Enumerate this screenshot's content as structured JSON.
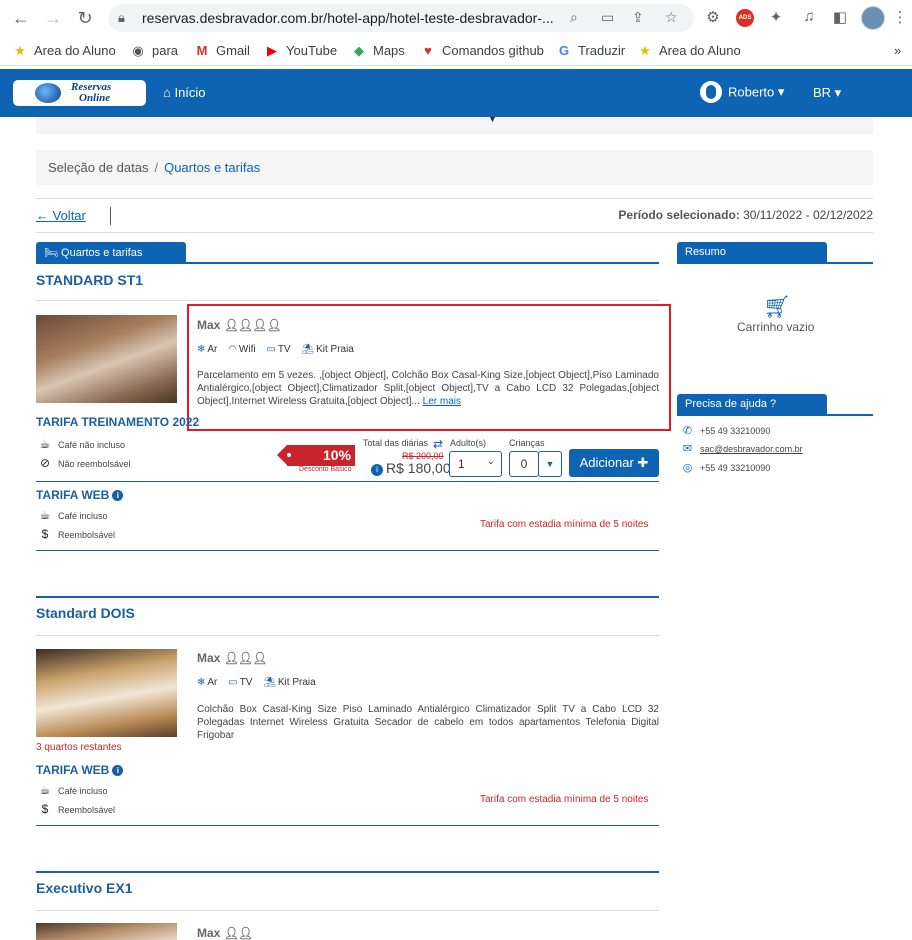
{
  "browser": {
    "url": "reservas.desbravador.com.br/hotel-app/hotel-teste-desbravador-...",
    "ads_badge": "ADS",
    "bookmarks": [
      {
        "icon": "★",
        "label": "Area do Aluno"
      },
      {
        "icon": "◉",
        "label": "para"
      },
      {
        "icon": "M",
        "label": "Gmail"
      },
      {
        "icon": "▶",
        "label": "YouTube"
      },
      {
        "icon": "◆",
        "label": "Maps"
      },
      {
        "icon": "♥",
        "label": "Comandos github"
      },
      {
        "icon": "G",
        "label": "Traduzir"
      },
      {
        "icon": "★",
        "label": "Area do Aluno"
      }
    ],
    "more": "»"
  },
  "site": {
    "logo_line1": "Reservas",
    "logo_line2": "Online",
    "home": "Início",
    "user": "Roberto",
    "lang": "BR",
    "accent": "#0e63b3"
  },
  "breadcrumb": {
    "step1": "Seleção de datas",
    "sep": "/",
    "step2": "Quartos e tarifas"
  },
  "voltar": "Voltar",
  "periodo": {
    "label": "Período selecionado:",
    "value": "30/11/2022 - 02/12/2022"
  },
  "rooms_tab": "Quartos e tarifas",
  "summary_tab": "Resumo",
  "cart_empty": "Carrinho vazio",
  "help_tab": "Precisa de ajuda ?",
  "contacts": [
    "+55 49 33210090",
    "sac@desbravador.com.br",
    "+55 49 33210090"
  ],
  "rooms": [
    {
      "title": "STANDARD ST1",
      "max": "Max",
      "amenities": [
        "Ar",
        "Wifi",
        "TV",
        "Kit Praia"
      ],
      "desc": "Parcelamento em 5 vezes. ,[object Object], Colchão Box Casal-King Size,[object Object],Piso Laminado Antialérgico,[object Object],Climatizador Split,[object Object],TV a Cabo LCD 32 Polegadas,[object Object],Internet Wireless Gratuita,[object Object]...",
      "more": "Ler mais",
      "tarifas": [
        {
          "name": "TARIFA TREINAMENTO 2022",
          "f1": "Café não incluso",
          "f2": "Não reembolsável",
          "discount": "10%",
          "discount_label": "Desconto Básico",
          "total_label": "Total das diárias",
          "old_price": "R$ 200,00",
          "price": "R$ 180,00",
          "adults_label": "Adulto(s)",
          "adults": "1",
          "children_label": "Crianças",
          "children": "0",
          "add": "Adicionar"
        },
        {
          "name": "TARIFA WEB",
          "f1": "Café incluso",
          "f2": "Reembolsável",
          "min_stay": "Tarifa com estadia mínima de 5 noites"
        }
      ]
    },
    {
      "title": "Standard DOIS",
      "max": "Max",
      "amenities": [
        "Ar",
        "TV",
        "Kit Praia"
      ],
      "desc": "Colchão Box Casal-King Size Piso Laminado Antialérgico Climatizador Split TV a Cabo LCD 32 Polegadas Internet Wireless Gratuita Secador de cabelo em todos apartamentos Telefonia Digital Frigobar",
      "remaining": "3 quartos restantes",
      "tarifa": {
        "name": "TARIFA WEB",
        "f1": "Café incluso",
        "f2": "Reembolsável",
        "min_stay": "Tarifa com estadia mínima de 5 noites"
      }
    },
    {
      "title": "Executivo EX1",
      "max": "Max"
    }
  ]
}
